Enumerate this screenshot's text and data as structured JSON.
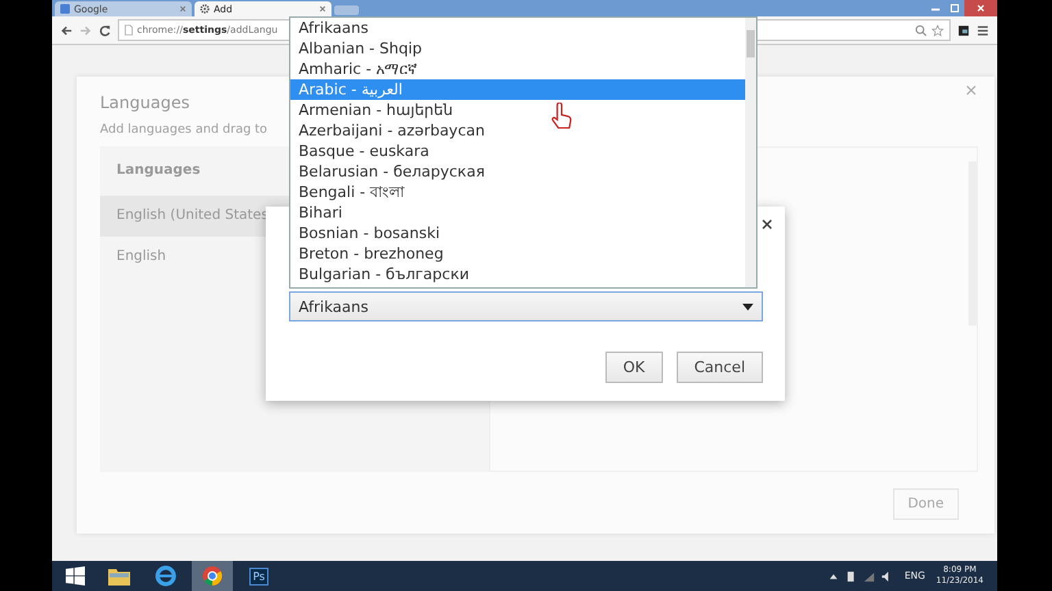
{
  "browser": {
    "tabs": [
      {
        "title": "Google",
        "kind": "google",
        "selected": false
      },
      {
        "title": "Add",
        "kind": "settings",
        "selected": true
      }
    ],
    "address": "chrome://**settings**/addLangu"
  },
  "settings": {
    "title": "Languages",
    "subtitle": "Add languages and drag to",
    "list_header": "Languages",
    "languages": [
      {
        "name": "English (United States",
        "selected": true
      },
      {
        "name": "English",
        "selected": false
      }
    ],
    "done_button": {
      "label": "Done",
      "disabled": true
    }
  },
  "dialog": {
    "select": {
      "value": "Afrikaans",
      "expanded": true,
      "options": [
        {
          "label": "Afrikaans",
          "highlighted": false
        },
        {
          "label": "Albanian - Shqip",
          "highlighted": false
        },
        {
          "label": "Amharic - አማርኛ",
          "highlighted": false
        },
        {
          "label": "Arabic - العربية",
          "highlighted": true
        },
        {
          "label": "Armenian - հայերեն",
          "highlighted": false
        },
        {
          "label": "Azerbaijani - azərbaycan",
          "highlighted": false
        },
        {
          "label": "Basque - euskara",
          "highlighted": false
        },
        {
          "label": "Belarusian - беларуская",
          "highlighted": false
        },
        {
          "label": "Bengali - বাংলা",
          "highlighted": false
        },
        {
          "label": "Bihari",
          "highlighted": false
        },
        {
          "label": "Bosnian - bosanski",
          "highlighted": false
        },
        {
          "label": "Breton - brezhoneg",
          "highlighted": false
        },
        {
          "label": "Bulgarian - български",
          "highlighted": false
        }
      ]
    },
    "buttons": [
      "OK",
      "Cancel"
    ]
  },
  "taskbar": {
    "apps": [
      {
        "kind": "explorer",
        "selected": false
      },
      {
        "kind": "ie",
        "selected": false
      },
      {
        "kind": "chrome",
        "selected": true
      },
      {
        "kind": "photoshop",
        "label": "Ps",
        "selected": false
      }
    ],
    "language": "ENG",
    "time": "8:09 PM",
    "date": "11/23/2014"
  }
}
